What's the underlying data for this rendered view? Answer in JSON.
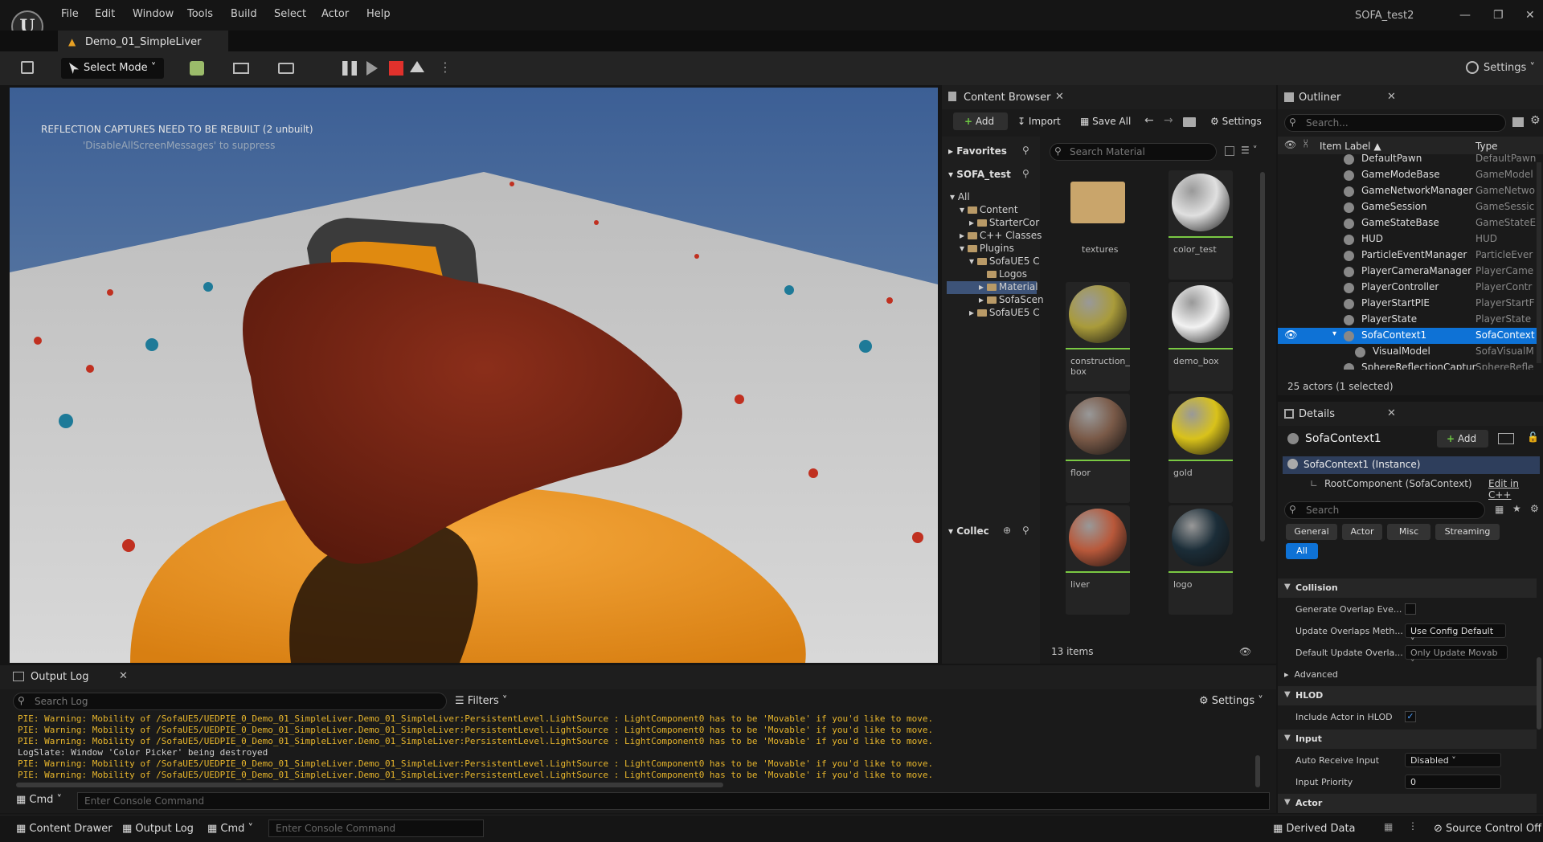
{
  "app": {
    "window_title": "SOFA_test2",
    "doc_tab": "Demo_01_SimpleLiver"
  },
  "menu": [
    "File",
    "Edit",
    "Window",
    "Tools",
    "Build",
    "Select",
    "Actor",
    "Help"
  ],
  "toolbar": {
    "select_mode": "Select Mode",
    "settings": "Settings"
  },
  "viewport": {
    "msg1": "REFLECTION CAPTURES NEED TO BE REBUILT (2 unbuilt)",
    "msg2": "'DisableAllScreenMessages' to suppress"
  },
  "content_browser": {
    "title": "Content Browser",
    "add": "Add",
    "import": "Import",
    "save_all": "Save All",
    "settings": "Settings",
    "favorites": "Favorites",
    "project": "SOFA_test",
    "collections": "Collec",
    "search_placeholder": "Search Material",
    "tree": [
      "All",
      "Content",
      "StarterCor",
      "C++ Classes",
      "Plugins",
      "SofaUE5 C",
      "Logos",
      "Material",
      "SofaScen",
      "SofaUE5 C"
    ],
    "assets": [
      {
        "name": "textures",
        "kind": "folder"
      },
      {
        "name": "color_test",
        "kind": "material",
        "color": "#e0e0e0"
      },
      {
        "name": "construction_\nbox",
        "kind": "material",
        "color": "#a99b3a"
      },
      {
        "name": "demo_box",
        "kind": "material",
        "color": "#f2f2f2"
      },
      {
        "name": "floor",
        "kind": "material",
        "color": "#7a5a48"
      },
      {
        "name": "gold",
        "kind": "material",
        "color": "#d9c21a"
      },
      {
        "name": "liver",
        "kind": "material",
        "color": "#b8583a"
      },
      {
        "name": "logo",
        "kind": "material",
        "color": "#1b2d38"
      }
    ],
    "count": "13 items"
  },
  "outliner": {
    "title": "Outliner",
    "search_placeholder": "Search...",
    "col_label": "Item Label",
    "col_type": "Type",
    "rows": [
      {
        "label": "DefaultPawn",
        "type": "DefaultPawn",
        "selected": false
      },
      {
        "label": "GameModeBase",
        "type": "GameModel",
        "selected": false
      },
      {
        "label": "GameNetworkManager",
        "type": "GameNetwo",
        "selected": false
      },
      {
        "label": "GameSession",
        "type": "GameSessic",
        "selected": false
      },
      {
        "label": "GameStateBase",
        "type": "GameStateE",
        "selected": false
      },
      {
        "label": "HUD",
        "type": "HUD",
        "selected": false
      },
      {
        "label": "ParticleEventManager",
        "type": "ParticleEver",
        "selected": false
      },
      {
        "label": "PlayerCameraManager",
        "type": "PlayerCame",
        "selected": false
      },
      {
        "label": "PlayerController",
        "type": "PlayerContr",
        "selected": false
      },
      {
        "label": "PlayerStartPIE",
        "type": "PlayerStartF",
        "selected": false
      },
      {
        "label": "PlayerState",
        "type": "PlayerState",
        "selected": false
      },
      {
        "label": "SofaContext1",
        "type": "SofaContext",
        "selected": true
      },
      {
        "label": "VisualModel",
        "type": "SofaVisualM",
        "selected": false
      },
      {
        "label": "SphereReflectionCaptur",
        "type": "SphereRefle",
        "selected": false
      }
    ],
    "status": "25 actors (1 selected)"
  },
  "details": {
    "title": "Details",
    "actor": "SofaContext1",
    "add": "Add",
    "instance": "SofaContext1 (Instance)",
    "root": "RootComponent (SofaContext)",
    "edit_cpp": "Edit in C++",
    "search_placeholder": "Search",
    "filters": [
      "General",
      "Actor",
      "Misc",
      "Streaming"
    ],
    "filter_all": "All",
    "collision": "Collision",
    "gen_overlap": "Generate Overlap Eve...",
    "upd_overlap": "Update Overlaps Meth...",
    "upd_overlap_val": "Use Config Default",
    "def_update": "Default Update Overla...",
    "def_update_val": "Only Update Movab",
    "advanced": "Advanced",
    "hlod": "HLOD",
    "include_hlod": "Include Actor in HLOD",
    "input": "Input",
    "auto_receive": "Auto Receive Input",
    "auto_receive_val": "Disabled",
    "input_priority": "Input Priority",
    "input_priority_val": "0",
    "actor_section": "Actor"
  },
  "output_log": {
    "title": "Output Log",
    "search_placeholder": "Search Log",
    "filters": "Filters",
    "settings": "Settings",
    "lines": [
      {
        "text": "PIE: Warning: Mobility of /SofaUE5/UEDPIE_0_Demo_01_SimpleLiver.Demo_01_SimpleLiver:PersistentLevel.LightSource : LightComponent0 has to be 'Movable' if you'd like to move.",
        "level": "warn"
      },
      {
        "text": "PIE: Warning: Mobility of /SofaUE5/UEDPIE_0_Demo_01_SimpleLiver.Demo_01_SimpleLiver:PersistentLevel.LightSource : LightComponent0 has to be 'Movable' if you'd like to move.",
        "level": "warn"
      },
      {
        "text": "PIE: Warning: Mobility of /SofaUE5/UEDPIE_0_Demo_01_SimpleLiver.Demo_01_SimpleLiver:PersistentLevel.LightSource : LightComponent0 has to be 'Movable' if you'd like to move.",
        "level": "warn"
      },
      {
        "text": "LogSlate: Window 'Color Picker' being destroyed",
        "level": "info"
      },
      {
        "text": "PIE: Warning: Mobility of /SofaUE5/UEDPIE_0_Demo_01_SimpleLiver.Demo_01_SimpleLiver:PersistentLevel.LightSource : LightComponent0 has to be 'Movable' if you'd like to move.",
        "level": "warn"
      },
      {
        "text": "PIE: Warning: Mobility of /SofaUE5/UEDPIE_0_Demo_01_SimpleLiver.Demo_01_SimpleLiver:PersistentLevel.LightSource : LightComponent0 has to be 'Movable' if you'd like to move.",
        "level": "warn"
      }
    ],
    "cmd": "Cmd",
    "console_placeholder": "Enter Console Command"
  },
  "statusbar": {
    "content_drawer": "Content Drawer",
    "output_log": "Output Log",
    "cmd": "Cmd",
    "console_placeholder": "Enter Console Command",
    "derived_data": "Derived Data",
    "source_control": "Source Control Off"
  },
  "colors": {
    "accent": "#0e72d6",
    "warn": "#e8b62c",
    "selected_row": "#0e72d6"
  }
}
